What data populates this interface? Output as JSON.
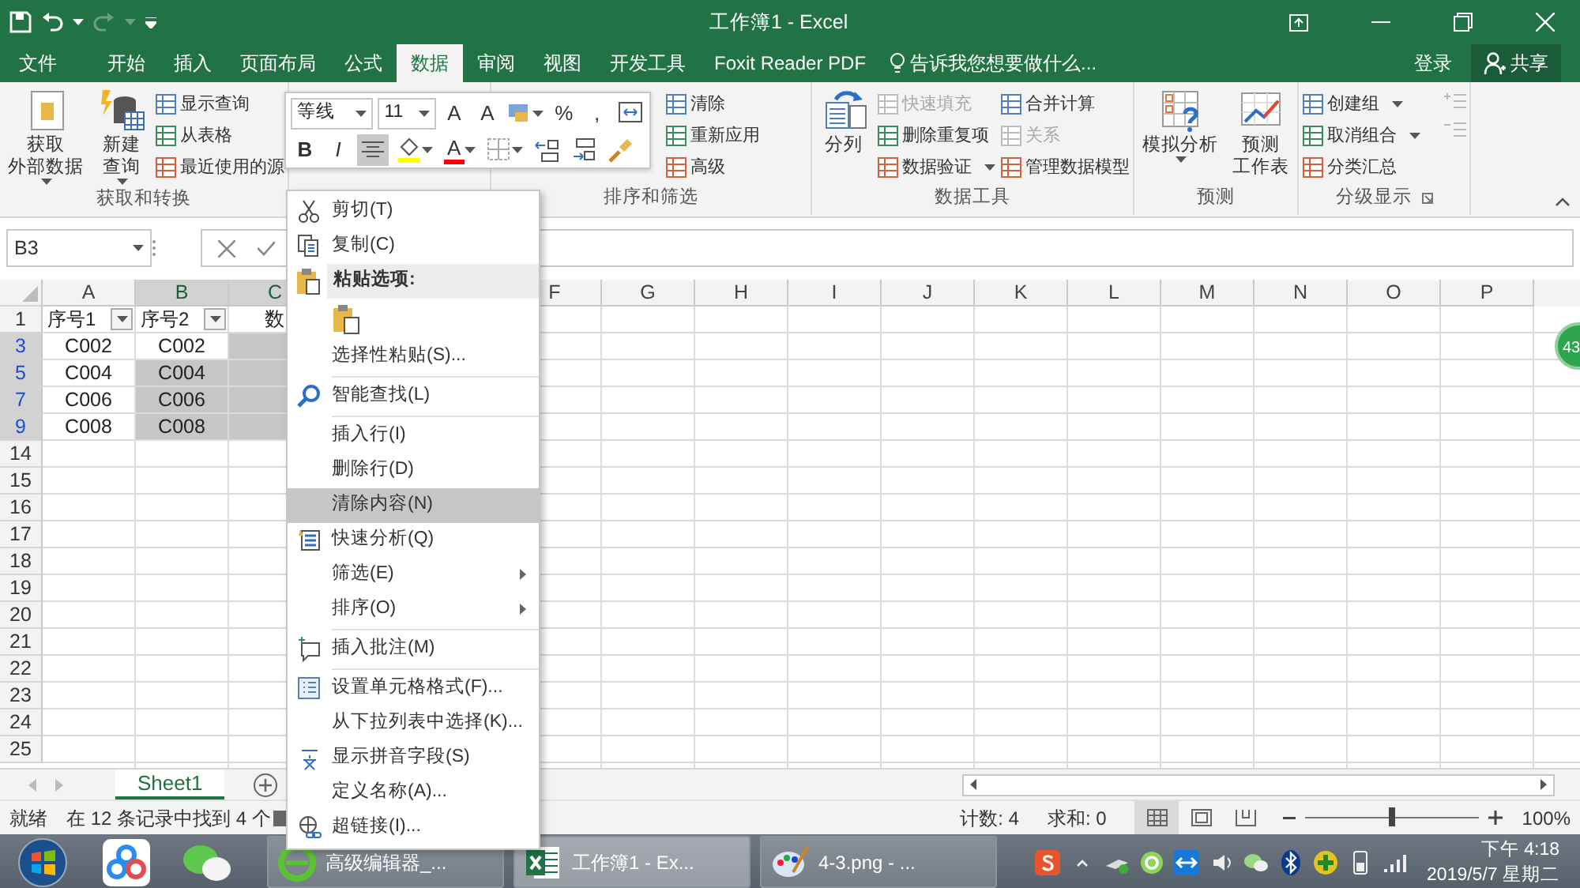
{
  "window": {
    "title": "工作簿1 - Excel"
  },
  "ribbon_tabs": [
    {
      "label": "文件",
      "selected": false
    },
    {
      "label": "开始",
      "selected": false
    },
    {
      "label": "插入",
      "selected": false
    },
    {
      "label": "页面布局",
      "selected": false
    },
    {
      "label": "公式",
      "selected": false
    },
    {
      "label": "数据",
      "selected": true
    },
    {
      "label": "审阅",
      "selected": false
    },
    {
      "label": "视图",
      "selected": false
    },
    {
      "label": "开发工具",
      "selected": false
    },
    {
      "label": "Foxit Reader PDF",
      "selected": false
    }
  ],
  "tell_me": "告诉我您想要做什么...",
  "sign_in": "登录",
  "share": "共享",
  "ribbon_groups": [
    {
      "label": "获取和转换",
      "commands": [
        {
          "kind": "large",
          "lines": [
            "获取",
            "外部数据"
          ],
          "dropdown": true
        },
        {
          "kind": "large",
          "lines": [
            "新建",
            "查询"
          ],
          "dropdown": true
        },
        {
          "kind": "stack",
          "items": [
            {
              "label": "显示查询",
              "disabled": false,
              "dropdown": false
            },
            {
              "label": "从表格",
              "disabled": false,
              "dropdown": false
            },
            {
              "label": "最近使用的源",
              "disabled": false,
              "dropdown": false
            }
          ]
        }
      ]
    },
    {
      "label": "排序和筛选",
      "commands": [
        {
          "kind": "stack",
          "items": [
            {
              "label": "清除",
              "disabled": false,
              "dropdown": false
            },
            {
              "label": "重新应用",
              "disabled": false,
              "dropdown": false
            },
            {
              "label": "高级",
              "disabled": false,
              "dropdown": false
            }
          ]
        }
      ]
    },
    {
      "label": "数据工具",
      "commands": [
        {
          "kind": "large",
          "lines": [
            "分列"
          ],
          "dropdown": false
        },
        {
          "kind": "stack",
          "items": [
            {
              "label": "快速填充",
              "disabled": true,
              "dropdown": false
            },
            {
              "label": "删除重复项",
              "disabled": false,
              "dropdown": false
            },
            {
              "label": "数据验证",
              "disabled": false,
              "dropdown": true
            }
          ]
        },
        {
          "kind": "stack",
          "items": [
            {
              "label": "合并计算",
              "disabled": false,
              "dropdown": false
            },
            {
              "label": "关系",
              "disabled": true,
              "dropdown": false
            },
            {
              "label": "管理数据模型",
              "disabled": false,
              "dropdown": false
            }
          ]
        }
      ]
    },
    {
      "label": "预测",
      "commands": [
        {
          "kind": "large",
          "lines": [
            "模拟分析"
          ],
          "dropdown": true
        },
        {
          "kind": "large",
          "lines": [
            "预测",
            "工作表"
          ],
          "dropdown": false
        }
      ]
    },
    {
      "label": "分级显示",
      "launcher": true,
      "commands": [
        {
          "kind": "stack",
          "items": [
            {
              "label": "创建组",
              "disabled": false,
              "dropdown": true
            },
            {
              "label": "取消组合",
              "disabled": false,
              "dropdown": true
            },
            {
              "label": "分类汇总",
              "disabled": false,
              "dropdown": false
            }
          ]
        },
        {
          "kind": "icons",
          "items": [
            {
              "disabled": true
            },
            {
              "disabled": true
            }
          ]
        }
      ]
    }
  ],
  "mini_toolbar": {
    "font": "等线",
    "size": "11",
    "row1": [
      {
        "kind": "grow",
        "glyph": "A"
      },
      {
        "kind": "shrink",
        "glyph": "A"
      },
      {
        "kind": "currency"
      },
      {
        "kind": "text",
        "glyph": "%"
      },
      {
        "kind": "text",
        "glyph": ","
      },
      {
        "kind": "wrap"
      }
    ],
    "row2": [
      {
        "kind": "text",
        "glyph": "B",
        "selected": false
      },
      {
        "kind": "italic",
        "glyph": "I",
        "selected": false
      },
      {
        "kind": "center",
        "selected": true
      },
      {
        "kind": "fill",
        "color": "#ffff00"
      },
      {
        "kind": "fontcolor",
        "glyph": "A",
        "color": "#ff0000"
      },
      {
        "kind": "border"
      },
      {
        "kind": "incdec"
      },
      {
        "kind": "decdec"
      },
      {
        "kind": "painter"
      }
    ]
  },
  "name_box": "B3",
  "columns": [
    {
      "label": "A",
      "selected": false
    },
    {
      "label": "B",
      "selected": true
    },
    {
      "label": "C",
      "selected": true
    },
    {
      "label": "F",
      "selected": false
    },
    {
      "label": "G",
      "selected": false
    },
    {
      "label": "H",
      "selected": false
    },
    {
      "label": "I",
      "selected": false
    },
    {
      "label": "J",
      "selected": false
    },
    {
      "label": "K",
      "selected": false
    },
    {
      "label": "L",
      "selected": false
    },
    {
      "label": "M",
      "selected": false
    },
    {
      "label": "N",
      "selected": false
    },
    {
      "label": "O",
      "selected": false
    },
    {
      "label": "P",
      "selected": false
    }
  ],
  "rows": [
    {
      "label": "1",
      "filtered": false,
      "selected": false,
      "cells": [
        {
          "text": "序号1",
          "filter": true,
          "selected": false
        },
        {
          "text": "序号2",
          "filter": true,
          "selected": false
        },
        {
          "text": "数",
          "filter": false,
          "selected": false
        }
      ]
    },
    {
      "label": "3",
      "filtered": true,
      "selected": true,
      "cells": [
        {
          "text": "C002",
          "selected": false
        },
        {
          "text": "C002",
          "selected": false
        },
        {
          "selected": true
        }
      ]
    },
    {
      "label": "5",
      "filtered": true,
      "selected": true,
      "cells": [
        {
          "text": "C004",
          "selected": false
        },
        {
          "text": "C004",
          "selected": true
        },
        {
          "selected": true
        }
      ]
    },
    {
      "label": "7",
      "filtered": true,
      "selected": true,
      "cells": [
        {
          "text": "C006",
          "selected": false
        },
        {
          "text": "C006",
          "selected": true
        },
        {
          "selected": true
        }
      ]
    },
    {
      "label": "9",
      "filtered": true,
      "selected": true,
      "cells": [
        {
          "text": "C008",
          "selected": false
        },
        {
          "text": "C008",
          "selected": true
        },
        {
          "selected": true
        }
      ]
    },
    {
      "label": "14",
      "filtered": false,
      "selected": false
    },
    {
      "label": "15",
      "filtered": false,
      "selected": false
    },
    {
      "label": "16",
      "filtered": false,
      "selected": false
    },
    {
      "label": "17",
      "filtered": false,
      "selected": false
    },
    {
      "label": "18",
      "filtered": false,
      "selected": false
    },
    {
      "label": "19",
      "filtered": false,
      "selected": false
    },
    {
      "label": "20",
      "filtered": false,
      "selected": false
    },
    {
      "label": "21",
      "filtered": false,
      "selected": false
    },
    {
      "label": "22",
      "filtered": false,
      "selected": false
    },
    {
      "label": "23",
      "filtered": false,
      "selected": false
    },
    {
      "label": "24",
      "filtered": false,
      "selected": false
    },
    {
      "label": "25",
      "filtered": false,
      "selected": false
    }
  ],
  "floating_badge": "43",
  "context_menu": [
    {
      "kind": "cut",
      "label": "剪切(T)",
      "selected": false
    },
    {
      "kind": "copy",
      "label": "复制(C)",
      "selected": false
    },
    {
      "kind": "header",
      "label": "粘贴选项:"
    },
    {
      "kind": "paste"
    },
    {
      "kind": "item",
      "label": "选择性粘贴(S)...",
      "selected": false
    },
    {
      "kind": "separator"
    },
    {
      "kind": "lookup",
      "label": "智能查找(L)",
      "selected": false
    },
    {
      "kind": "separator"
    },
    {
      "kind": "item",
      "label": "插入行(I)",
      "selected": false
    },
    {
      "kind": "item",
      "label": "删除行(D)",
      "selected": false
    },
    {
      "kind": "item",
      "label": "清除内容(N)",
      "selected": true
    },
    {
      "kind": "analysis",
      "label": "快速分析(Q)",
      "selected": false
    },
    {
      "kind": "item",
      "label": "筛选(E)",
      "submenu": true,
      "selected": false
    },
    {
      "kind": "item",
      "label": "排序(O)",
      "submenu": true,
      "selected": false
    },
    {
      "kind": "separator"
    },
    {
      "kind": "comment",
      "label": "插入批注(M)",
      "selected": false
    },
    {
      "kind": "separator"
    },
    {
      "kind": "format",
      "label": "设置单元格格式(F)...",
      "selected": false
    },
    {
      "kind": "item",
      "label": "从下拉列表中选择(K)...",
      "selected": false
    },
    {
      "kind": "pinyin",
      "label": "显示拼音字段(S)",
      "selected": false
    },
    {
      "kind": "item",
      "label": "定义名称(A)...",
      "selected": false
    },
    {
      "kind": "link",
      "label": "超链接(I)...",
      "selected": false
    }
  ],
  "sheet_tabs": [
    {
      "label": "Sheet1",
      "selected": true
    }
  ],
  "status_bar": {
    "ready": "就绪",
    "message": "在 12 条记录中找到 4 个",
    "count": "计数: 4",
    "sum": "求和: 0",
    "views": [
      {
        "kind": "normal",
        "selected": true
      },
      {
        "kind": "layout",
        "selected": false
      },
      {
        "kind": "break",
        "selected": false
      }
    ],
    "zoom": {
      "level": 0.5,
      "reading": "100%"
    }
  },
  "taskbar": {
    "tasks": [
      {
        "kind": "browser",
        "label": "高级编辑器_...",
        "selected": false
      },
      {
        "kind": "excel",
        "label": "工作簿1 - Ex...",
        "selected": true
      },
      {
        "kind": "paint",
        "label": "4-3.png - ...",
        "selected": false
      }
    ],
    "time": "下午 4:18",
    "date": "2019/5/7 星期二"
  }
}
